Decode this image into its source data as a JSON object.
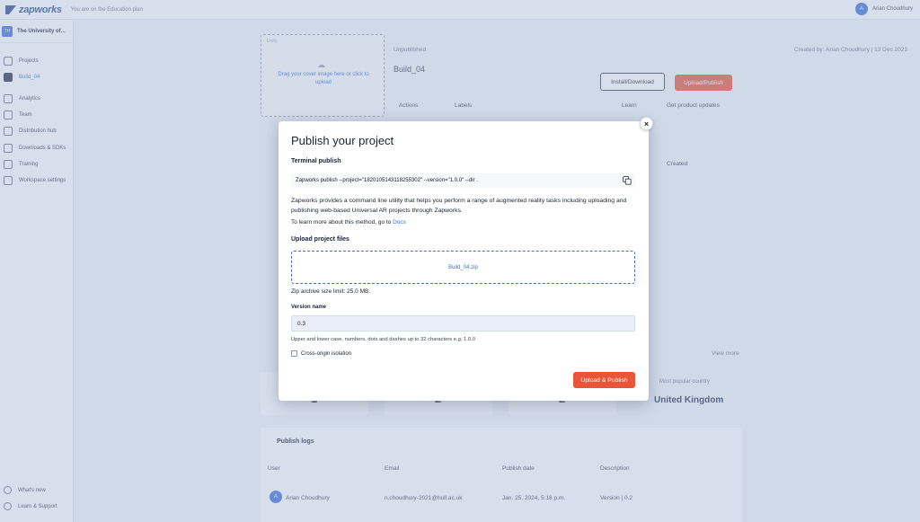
{
  "topbar": {
    "logo_text": "zapworks",
    "plan_text": "You are on the Education plan",
    "user_initial": "A",
    "user_name": "Arian Choudhury"
  },
  "sidebar": {
    "org_badge": "TH",
    "org_name": "The University of...",
    "items": [
      {
        "label": "Projects"
      },
      {
        "label": "Build_04"
      },
      {
        "label": "Analytics"
      },
      {
        "label": "Team"
      },
      {
        "label": "Distribution hub"
      },
      {
        "label": "Downloads & SDKs"
      },
      {
        "label": "Training"
      },
      {
        "label": "Workspace settings"
      }
    ],
    "footer": [
      {
        "label": "What's new"
      },
      {
        "label": "Learn & Support"
      }
    ]
  },
  "project": {
    "cover_tag": "Unity",
    "cover_text": "Drag your cover image here or click to upload",
    "status": "Unpublished",
    "title": "Build_04",
    "created_by": "Created by: Arian Choudhury | 13 Dec 2023",
    "install_label": "Install/Download",
    "publish_label": "Upload/Publish",
    "actions_label": "Actions",
    "labels_label": "Labels",
    "learn_label": "Learn",
    "updates_label": "Get product updates",
    "created_col": "Created",
    "view_more": "View more",
    "stats": [
      "1",
      "2",
      "2"
    ],
    "popular_title": "Most popular country",
    "popular_value": "United Kingdom"
  },
  "logs": {
    "title": "Publish logs",
    "columns": [
      "User",
      "Email",
      "Publish date",
      "Description"
    ],
    "row": {
      "initial": "A",
      "user": "Arian Choudhury",
      "email": "n.choudhury-2021@hull.ac.uk",
      "date": "Jan. 25, 2024, 5:18 p.m.",
      "description": "Version | 0.2"
    }
  },
  "modal": {
    "title": "Publish your project",
    "terminal_label": "Terminal publish",
    "command": "Zapworks publish --project=\"1820105143118255302\" --version=\"1.0.0\" --dir .",
    "description": "Zapworks provides a command line utility that helps you perform a range of augmented reality tasks including uploading and publishing web-based Universal AR projects through Zapworks.",
    "learn_more_prefix": "To learn more about this method, go to",
    "docs_link": "Docs",
    "upload_label": "Upload project files",
    "file_name": "Build_04.zip",
    "zip_limit": "Zip archive size limit: 25.0 MB.",
    "version_label": "Version name",
    "version_value": "0.3",
    "version_help": "Upper and lower case, numbers, dots and dashes up to 32 characters e.g. 1.0.0",
    "cross_origin_label": "Cross-origin isolation",
    "submit_label": "Upload & Publish",
    "close_glyph": "×"
  },
  "colors": {
    "accent": "#3f6fd6",
    "primary_action": "#e8563a",
    "overlay": "#a0b2d2"
  }
}
